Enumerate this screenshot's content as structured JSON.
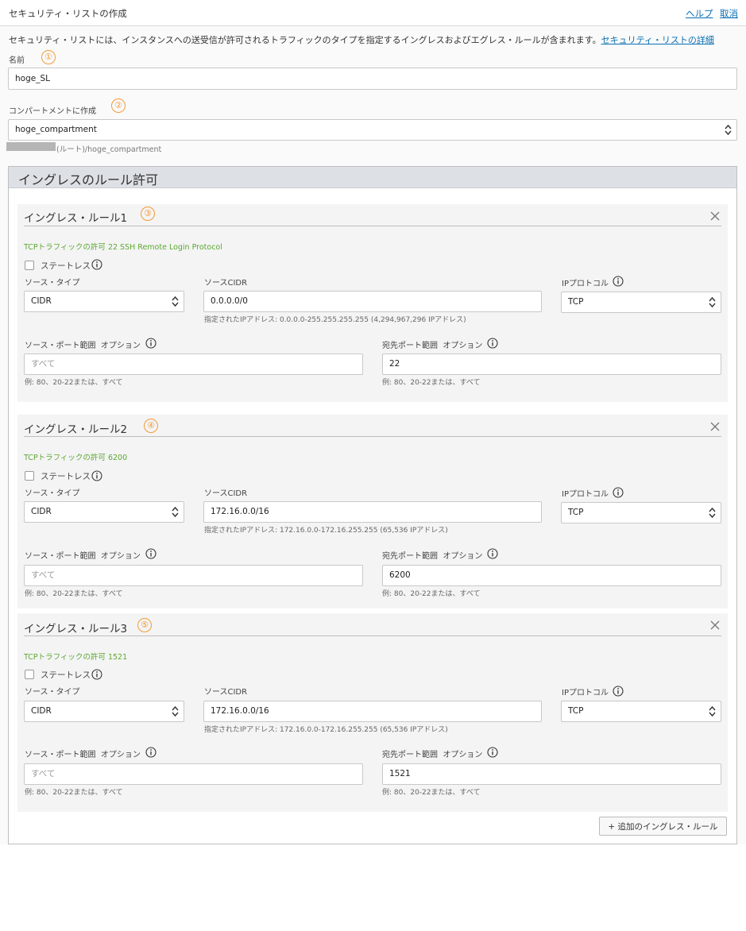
{
  "header": {
    "title": "セキュリティ・リストの作成",
    "help": "ヘルプ",
    "cancel": "取消"
  },
  "description": "セキュリティ・リストには、インスタンスへの送受信が許可されるトラフィックのタイプを指定するイングレスおよびエグレス・ルールが含まれます。",
  "description_link": "セキュリティ・リストの詳細",
  "name_field": {
    "label": "名前",
    "value": "hoge_SL",
    "marker": "①"
  },
  "compartment": {
    "label": "コンパートメントに作成",
    "value": "hoge_compartment",
    "path": "(ルート)/hoge_compartment",
    "marker": "②"
  },
  "ingress_section": {
    "title": "イングレスのルール許可",
    "add_button": "+ 追加のイングレス・ルール"
  },
  "rule_labels": {
    "stateless": "ステートレス",
    "source_type": "ソース・タイプ",
    "source_cidr": "ソースCIDR",
    "ip_protocol": "IPプロトコル",
    "source_port": "ソース・ポート範囲",
    "dest_port": "宛先ポート範囲",
    "optional": "オプション",
    "port_placeholder": "すべて",
    "port_hint": "例: 80、20-22または、すべて"
  },
  "rules": [
    {
      "title": "イングレス・ルール1",
      "marker": "③",
      "summary": "TCPトラフィックの許可 22 SSH Remote Login Protocol",
      "source_type": "CIDR",
      "source_cidr": "0.0.0.0/0",
      "cidr_hint": "指定されたIPアドレス: 0.0.0.0-255.255.255.255 (4,294,967,296 IPアドレス)",
      "protocol": "TCP",
      "source_port": "",
      "dest_port": "22"
    },
    {
      "title": "イングレス・ルール2",
      "marker": "④",
      "summary": "TCPトラフィックの許可 6200",
      "source_type": "CIDR",
      "source_cidr": "172.16.0.0/16",
      "cidr_hint": "指定されたIPアドレス: 172.16.0.0-172.16.255.255 (65,536 IPアドレス)",
      "protocol": "TCP",
      "source_port": "",
      "dest_port": "6200"
    },
    {
      "title": "イングレス・ルール3",
      "marker": "⑤",
      "summary": "TCPトラフィックの許可 1521",
      "source_type": "CIDR",
      "source_cidr": "172.16.0.0/16",
      "cidr_hint": "指定されたIPアドレス: 172.16.0.0-172.16.255.255 (65,536 IPアドレス)",
      "protocol": "TCP",
      "source_port": "",
      "dest_port": "1521"
    }
  ],
  "colors": {
    "accent_link": "#0a6fb4",
    "marker": "#f29b38",
    "summary_green": "#5ca832",
    "section_header": "#dde0e4"
  }
}
